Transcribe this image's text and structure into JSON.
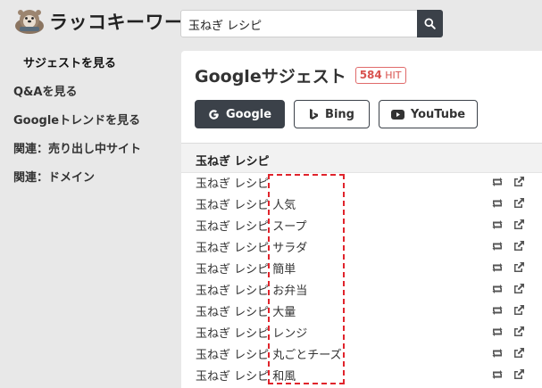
{
  "app": {
    "logo_text": "ラッコキーワード"
  },
  "search": {
    "value": "玉ねぎ レシピ"
  },
  "sidebar": {
    "items": [
      {
        "label": "サジェストを見る",
        "active": true
      },
      {
        "label": "Q&Aを見る"
      },
      {
        "label": "Googleトレンドを見る"
      },
      {
        "label": "関連：売り出し中サイト"
      },
      {
        "label": "関連：ドメイン"
      }
    ]
  },
  "main": {
    "title": "Googleサジェスト",
    "hit": {
      "count": "584",
      "unit": "HIT"
    },
    "engines": [
      {
        "label": "Google",
        "icon": "google-icon",
        "selected": true
      },
      {
        "label": "Bing",
        "icon": "bing-icon"
      },
      {
        "label": "YouTube",
        "icon": "youtube-icon"
      }
    ],
    "header_keyword": "玉ねぎ レシピ",
    "rows": [
      "玉ねぎ レシピ",
      "玉ねぎ レシピ 人気",
      "玉ねぎ レシピ スープ",
      "玉ねぎ レシピ サラダ",
      "玉ねぎ レシピ 簡単",
      "玉ねぎ レシピ お弁当",
      "玉ねぎ レシピ 大量",
      "玉ねぎ レシピ レンジ",
      "玉ねぎ レシピ 丸ごとチーズ",
      "玉ねぎ レシピ 和風"
    ]
  },
  "colors": {
    "accent": "#3b4149",
    "hit_red": "#d9534f",
    "highlight": "#e0242c"
  }
}
